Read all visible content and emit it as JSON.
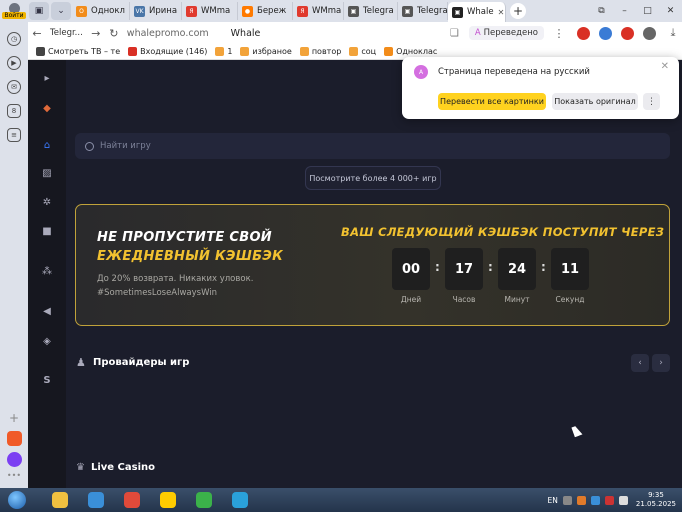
{
  "browser": {
    "profile_badge": "Войти",
    "tabs": [
      {
        "label": "Однокл",
        "fav": "#f28c1a",
        "favtxt": "О"
      },
      {
        "label": "Ирина",
        "fav": "#4a76a8",
        "favtxt": "VK"
      },
      {
        "label": "WMma",
        "fav": "#e03a2e",
        "favtxt": "Я"
      },
      {
        "label": "Береж",
        "fav": "#ff7a00",
        "favtxt": "●"
      },
      {
        "label": "WMma",
        "fav": "#e03a2e",
        "favtxt": "Я"
      },
      {
        "label": "Telegra",
        "fav": "#555555",
        "favtxt": "▣"
      },
      {
        "label": "Telegra",
        "fav": "#555555",
        "favtxt": "▣"
      },
      {
        "label": "Whale",
        "fav": "#222222",
        "favtxt": "▣",
        "active": true
      }
    ],
    "address": {
      "back_tab": "Telegr...",
      "url": "whalepromo.com",
      "page_title": "Whale",
      "translated_label": "Переведено"
    },
    "bookmarks": [
      {
        "label": "Смотреть ТВ – те",
        "color": "#444"
      },
      {
        "label": "Входящие (146)",
        "color": "#d93025"
      },
      {
        "label": "1",
        "color": "#f2a33a"
      },
      {
        "label": "избраное",
        "color": "#f2a33a"
      },
      {
        "label": "повтор",
        "color": "#f2a33a"
      },
      {
        "label": "соц",
        "color": "#f2a33a"
      },
      {
        "label": "Одноклас",
        "color": "#f28c1a"
      }
    ],
    "extension_colors": [
      "#d93025",
      "#3a7bd5",
      "#d93025",
      "#666666"
    ]
  },
  "translate_popup": {
    "message": "Страница переведена на русский",
    "translate_all_button": "Перевести все картинки",
    "show_original_button": "Показать оригинал"
  },
  "site": {
    "search_placeholder": "Найти игру",
    "more_games_button": "Посмотрите более 4 000+ игр",
    "cashback": {
      "title_line1": "НЕ ПРОПУСТИТЕ СВОЙ",
      "title_line2": "ЕЖЕДНЕВНЫЙ КЭШБЭК",
      "subtitle": "До 20% возврата. Никаких уловок.",
      "hashtag": "#SometimesLoseAlwaysWin",
      "next_heading": "ВАШ СЛЕДУЮЩИЙ КЭШБЭК ПОСТУПИТ ЧЕРЕЗ",
      "timer": [
        {
          "value": "00",
          "label": "Дней"
        },
        {
          "value": "17",
          "label": "Часов"
        },
        {
          "value": "24",
          "label": "Минут"
        },
        {
          "value": "11",
          "label": "Секунд"
        }
      ]
    },
    "providers_title": "Провайдеры игр",
    "live_casino_title": "Live Casino"
  },
  "taskbar": {
    "apps": [
      "#f0c040",
      "#3a8fd8",
      "#e04a3a",
      "#ffcc00",
      "#3bb24a",
      "#2aa1da"
    ],
    "lang": "EN",
    "time": "9:35",
    "date": "21.05.2025"
  }
}
